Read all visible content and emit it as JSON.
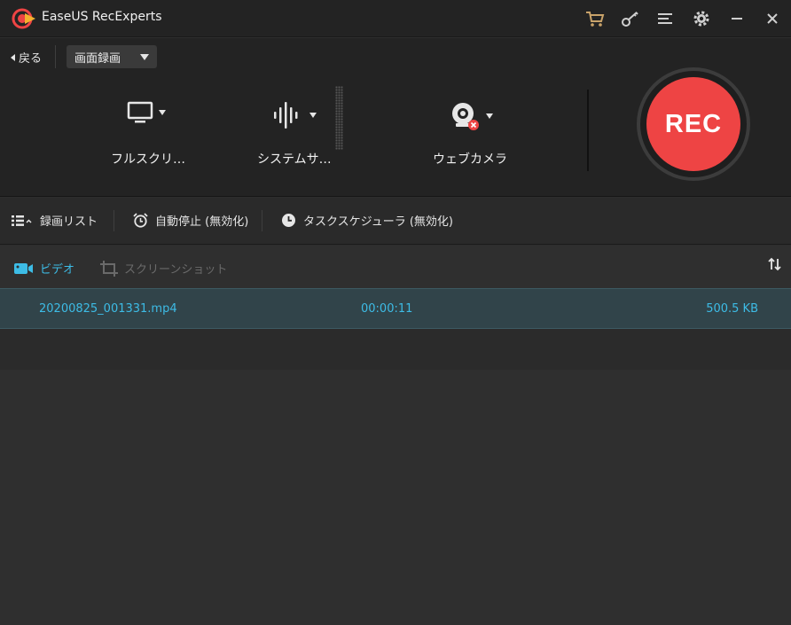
{
  "titlebar": {
    "title": "EaseUS RecExperts",
    "icons": [
      "cart-icon",
      "key-icon",
      "menu-icon",
      "settings-icon",
      "minimize-icon",
      "close-icon"
    ]
  },
  "mode_bar": {
    "back_label": "戻る",
    "mode_selected": "画面録画"
  },
  "sources": {
    "screen_label": "フルスクリ…",
    "audio_label": "システムサ…",
    "webcam_label": "ウェブカメラ"
  },
  "rec_button_label": "REC",
  "options": {
    "recording_list_label": "録画リスト",
    "auto_stop_label": "自動停止 (無効化)",
    "task_scheduler_label": "タスクスケジューラ (無効化)"
  },
  "tabs": {
    "video_label": "ビデオ",
    "screenshot_label": "スクリーンショット"
  },
  "files": [
    {
      "name": "20200825_001331.mp4",
      "duration": "00:00:11",
      "size": "500.5 KB"
    }
  ],
  "colors": {
    "accent": "#3dbce6",
    "rec_red": "#ee4444",
    "background": "#2d2d2d",
    "panel": "#232323"
  }
}
